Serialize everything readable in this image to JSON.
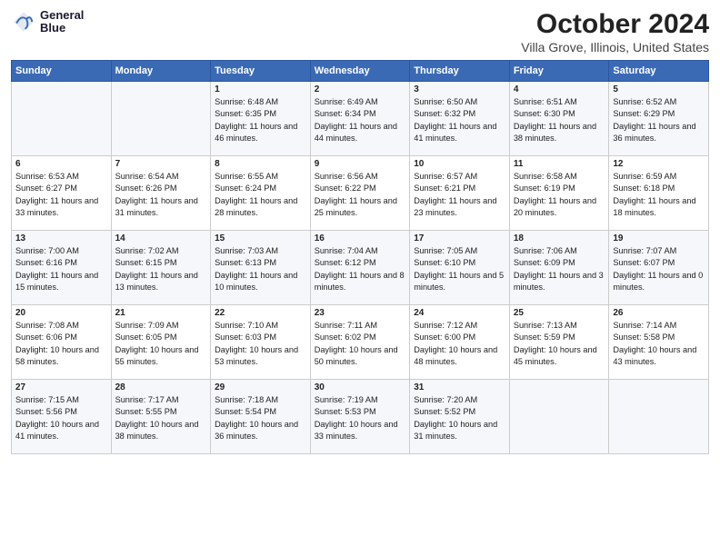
{
  "header": {
    "logo_line1": "General",
    "logo_line2": "Blue",
    "month": "October 2024",
    "location": "Villa Grove, Illinois, United States"
  },
  "weekdays": [
    "Sunday",
    "Monday",
    "Tuesday",
    "Wednesday",
    "Thursday",
    "Friday",
    "Saturday"
  ],
  "weeks": [
    [
      {
        "day": "",
        "sunrise": "",
        "sunset": "",
        "daylight": ""
      },
      {
        "day": "",
        "sunrise": "",
        "sunset": "",
        "daylight": ""
      },
      {
        "day": "1",
        "sunrise": "Sunrise: 6:48 AM",
        "sunset": "Sunset: 6:35 PM",
        "daylight": "Daylight: 11 hours and 46 minutes."
      },
      {
        "day": "2",
        "sunrise": "Sunrise: 6:49 AM",
        "sunset": "Sunset: 6:34 PM",
        "daylight": "Daylight: 11 hours and 44 minutes."
      },
      {
        "day": "3",
        "sunrise": "Sunrise: 6:50 AM",
        "sunset": "Sunset: 6:32 PM",
        "daylight": "Daylight: 11 hours and 41 minutes."
      },
      {
        "day": "4",
        "sunrise": "Sunrise: 6:51 AM",
        "sunset": "Sunset: 6:30 PM",
        "daylight": "Daylight: 11 hours and 38 minutes."
      },
      {
        "day": "5",
        "sunrise": "Sunrise: 6:52 AM",
        "sunset": "Sunset: 6:29 PM",
        "daylight": "Daylight: 11 hours and 36 minutes."
      }
    ],
    [
      {
        "day": "6",
        "sunrise": "Sunrise: 6:53 AM",
        "sunset": "Sunset: 6:27 PM",
        "daylight": "Daylight: 11 hours and 33 minutes."
      },
      {
        "day": "7",
        "sunrise": "Sunrise: 6:54 AM",
        "sunset": "Sunset: 6:26 PM",
        "daylight": "Daylight: 11 hours and 31 minutes."
      },
      {
        "day": "8",
        "sunrise": "Sunrise: 6:55 AM",
        "sunset": "Sunset: 6:24 PM",
        "daylight": "Daylight: 11 hours and 28 minutes."
      },
      {
        "day": "9",
        "sunrise": "Sunrise: 6:56 AM",
        "sunset": "Sunset: 6:22 PM",
        "daylight": "Daylight: 11 hours and 25 minutes."
      },
      {
        "day": "10",
        "sunrise": "Sunrise: 6:57 AM",
        "sunset": "Sunset: 6:21 PM",
        "daylight": "Daylight: 11 hours and 23 minutes."
      },
      {
        "day": "11",
        "sunrise": "Sunrise: 6:58 AM",
        "sunset": "Sunset: 6:19 PM",
        "daylight": "Daylight: 11 hours and 20 minutes."
      },
      {
        "day": "12",
        "sunrise": "Sunrise: 6:59 AM",
        "sunset": "Sunset: 6:18 PM",
        "daylight": "Daylight: 11 hours and 18 minutes."
      }
    ],
    [
      {
        "day": "13",
        "sunrise": "Sunrise: 7:00 AM",
        "sunset": "Sunset: 6:16 PM",
        "daylight": "Daylight: 11 hours and 15 minutes."
      },
      {
        "day": "14",
        "sunrise": "Sunrise: 7:02 AM",
        "sunset": "Sunset: 6:15 PM",
        "daylight": "Daylight: 11 hours and 13 minutes."
      },
      {
        "day": "15",
        "sunrise": "Sunrise: 7:03 AM",
        "sunset": "Sunset: 6:13 PM",
        "daylight": "Daylight: 11 hours and 10 minutes."
      },
      {
        "day": "16",
        "sunrise": "Sunrise: 7:04 AM",
        "sunset": "Sunset: 6:12 PM",
        "daylight": "Daylight: 11 hours and 8 minutes."
      },
      {
        "day": "17",
        "sunrise": "Sunrise: 7:05 AM",
        "sunset": "Sunset: 6:10 PM",
        "daylight": "Daylight: 11 hours and 5 minutes."
      },
      {
        "day": "18",
        "sunrise": "Sunrise: 7:06 AM",
        "sunset": "Sunset: 6:09 PM",
        "daylight": "Daylight: 11 hours and 3 minutes."
      },
      {
        "day": "19",
        "sunrise": "Sunrise: 7:07 AM",
        "sunset": "Sunset: 6:07 PM",
        "daylight": "Daylight: 11 hours and 0 minutes."
      }
    ],
    [
      {
        "day": "20",
        "sunrise": "Sunrise: 7:08 AM",
        "sunset": "Sunset: 6:06 PM",
        "daylight": "Daylight: 10 hours and 58 minutes."
      },
      {
        "day": "21",
        "sunrise": "Sunrise: 7:09 AM",
        "sunset": "Sunset: 6:05 PM",
        "daylight": "Daylight: 10 hours and 55 minutes."
      },
      {
        "day": "22",
        "sunrise": "Sunrise: 7:10 AM",
        "sunset": "Sunset: 6:03 PM",
        "daylight": "Daylight: 10 hours and 53 minutes."
      },
      {
        "day": "23",
        "sunrise": "Sunrise: 7:11 AM",
        "sunset": "Sunset: 6:02 PM",
        "daylight": "Daylight: 10 hours and 50 minutes."
      },
      {
        "day": "24",
        "sunrise": "Sunrise: 7:12 AM",
        "sunset": "Sunset: 6:00 PM",
        "daylight": "Daylight: 10 hours and 48 minutes."
      },
      {
        "day": "25",
        "sunrise": "Sunrise: 7:13 AM",
        "sunset": "Sunset: 5:59 PM",
        "daylight": "Daylight: 10 hours and 45 minutes."
      },
      {
        "day": "26",
        "sunrise": "Sunrise: 7:14 AM",
        "sunset": "Sunset: 5:58 PM",
        "daylight": "Daylight: 10 hours and 43 minutes."
      }
    ],
    [
      {
        "day": "27",
        "sunrise": "Sunrise: 7:15 AM",
        "sunset": "Sunset: 5:56 PM",
        "daylight": "Daylight: 10 hours and 41 minutes."
      },
      {
        "day": "28",
        "sunrise": "Sunrise: 7:17 AM",
        "sunset": "Sunset: 5:55 PM",
        "daylight": "Daylight: 10 hours and 38 minutes."
      },
      {
        "day": "29",
        "sunrise": "Sunrise: 7:18 AM",
        "sunset": "Sunset: 5:54 PM",
        "daylight": "Daylight: 10 hours and 36 minutes."
      },
      {
        "day": "30",
        "sunrise": "Sunrise: 7:19 AM",
        "sunset": "Sunset: 5:53 PM",
        "daylight": "Daylight: 10 hours and 33 minutes."
      },
      {
        "day": "31",
        "sunrise": "Sunrise: 7:20 AM",
        "sunset": "Sunset: 5:52 PM",
        "daylight": "Daylight: 10 hours and 31 minutes."
      },
      {
        "day": "",
        "sunrise": "",
        "sunset": "",
        "daylight": ""
      },
      {
        "day": "",
        "sunrise": "",
        "sunset": "",
        "daylight": ""
      }
    ]
  ]
}
